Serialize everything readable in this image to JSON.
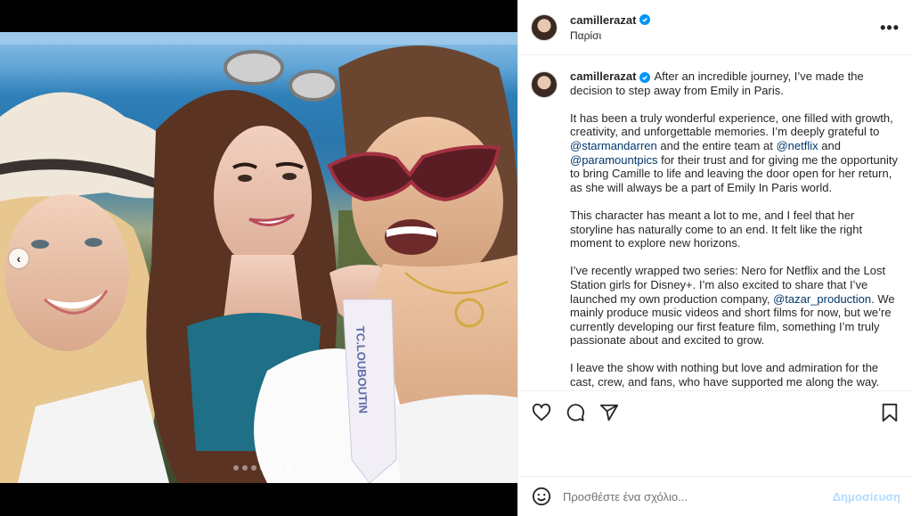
{
  "post": {
    "username": "camillerazat",
    "location": "Παρίσι",
    "verified": true
  },
  "carousel": {
    "slide_count": 7,
    "active_slide": 7
  },
  "caption": {
    "username": "camillerazat",
    "paragraphs": [
      [
        {
          "text": "After an incredible journey, I’ve made the decision to step away from Emily in Paris."
        }
      ],
      [
        {
          "text": "It has been a truly wonderful experience, one filled with growth, creativity, and unforgettable memories. I’m deeply grateful to "
        },
        {
          "text": "@starmandarren",
          "mention": true
        },
        {
          "text": " and the entire team at "
        },
        {
          "text": "@netflix",
          "mention": true
        },
        {
          "text": " and "
        },
        {
          "text": "@paramountpics",
          "mention": true
        },
        {
          "text": " for their trust and for giving me the opportunity to bring Camille to life and leaving the door open for her return, as she will always be a part of Emily In Paris world."
        }
      ],
      [
        {
          "text": "This character has meant a lot to me, and I feel that her storyline has naturally come to an end. It felt like the right moment to explore new horizons."
        }
      ],
      [
        {
          "text": "I’ve recently wrapped two series: Nero for Netflix and the Lost Station girls for Disney+. I’m also excited to share that I’ve launched my own production company, "
        },
        {
          "text": "@tazar_production",
          "mention": true
        },
        {
          "text": ". We mainly produce music videos and short films for now, but we’re currently developing our first feature film, something I’m truly passionate about and excited to grow."
        }
      ],
      [
        {
          "text": "I leave the show with nothing but love and admiration for the cast, crew, and fans, who have supported me along the way. Thank you for"
        }
      ]
    ]
  },
  "actions": {
    "like": "heart-icon",
    "comment": "comment-icon",
    "share": "share-icon",
    "save": "bookmark-icon"
  },
  "comment": {
    "placeholder": "Προσθέστε ένα σχόλιο...",
    "post_label": "Δημοσίευση"
  },
  "colors": {
    "mention": "#00376b",
    "verified": "#0095f6",
    "post_button": "#b3dbff"
  }
}
